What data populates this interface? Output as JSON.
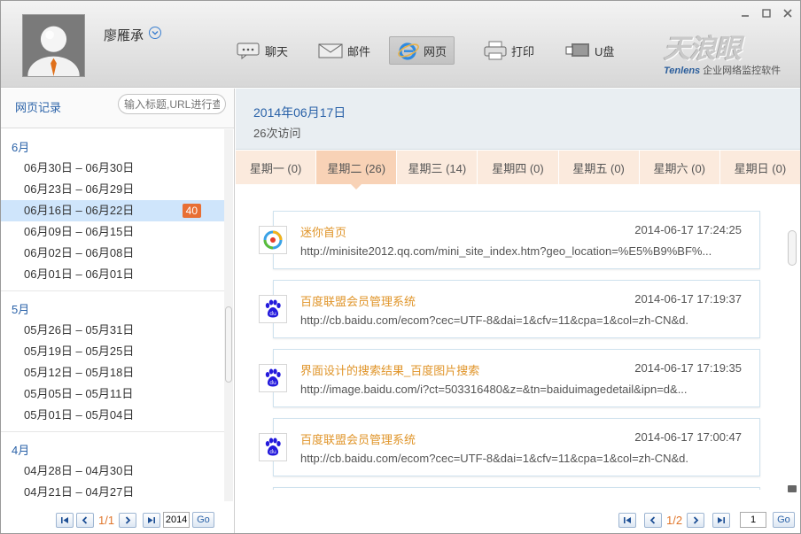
{
  "user": {
    "name": "廖雁承"
  },
  "nav": [
    {
      "label": "聊天",
      "icon": "chat-icon"
    },
    {
      "label": "邮件",
      "icon": "mail-icon"
    },
    {
      "label": "网页",
      "icon": "ie-icon",
      "active": true
    },
    {
      "label": "打印",
      "icon": "printer-icon"
    },
    {
      "label": "U盘",
      "icon": "usb-drive-icon"
    }
  ],
  "brand": {
    "logo": "天浪眼",
    "en": "Tenlens",
    "tagline": "企业网络监控软件"
  },
  "sidebar": {
    "title": "网页记录",
    "search_placeholder": "输入标题,URL进行查",
    "months": [
      {
        "name": "6月",
        "weeks": [
          {
            "label": "06月30日 – 06月30日"
          },
          {
            "label": "06月23日 – 06月29日"
          },
          {
            "label": "06月16日 – 06月22日",
            "count": "40",
            "selected": true
          },
          {
            "label": "06月09日 – 06月15日"
          },
          {
            "label": "06月02日 – 06月08日"
          },
          {
            "label": "06月01日 – 06月01日"
          }
        ]
      },
      {
        "name": "5月",
        "weeks": [
          {
            "label": "05月26日 – 05月31日"
          },
          {
            "label": "05月19日 – 05月25日"
          },
          {
            "label": "05月12日 – 05月18日"
          },
          {
            "label": "05月05日 – 05月11日"
          },
          {
            "label": "05月01日 – 05月04日"
          }
        ]
      },
      {
        "name": "4月",
        "weeks": [
          {
            "label": "04月28日 – 04月30日"
          },
          {
            "label": "04月21日 – 04月27日"
          }
        ]
      }
    ],
    "pager": {
      "page": "1/1",
      "year": "2014",
      "go": "Go"
    }
  },
  "main": {
    "date": "2014年06月17日",
    "visits": "26次访问",
    "tabs": [
      {
        "label": "星期一 (0)"
      },
      {
        "label": "星期二 (26)",
        "active": true
      },
      {
        "label": "星期三 (14)"
      },
      {
        "label": "星期四 (0)"
      },
      {
        "label": "星期五 (0)"
      },
      {
        "label": "星期六 (0)"
      },
      {
        "label": "星期日 (0)"
      }
    ],
    "records": [
      {
        "title": "迷你首页",
        "time": "2014-06-17 17:24:25",
        "url": "http://minisite2012.qq.com/mini_site_index.htm?geo_location=%E5%B9%BF%...",
        "icon": "qq-news-icon"
      },
      {
        "title": "百度联盟会员管理系统",
        "time": "2014-06-17 17:19:37",
        "url": "http://cb.baidu.com/ecom?cec=UTF-8&dai=1&cfv=11&cpa=1&col=zh-CN&d.",
        "icon": "baidu-icon"
      },
      {
        "title": "界面设计的搜索结果_百度图片搜索",
        "time": "2014-06-17 17:19:35",
        "url": "http://image.baidu.com/i?ct=503316480&z=&tn=baiduimagedetail&ipn=d&...",
        "icon": "baidu-icon"
      },
      {
        "title": "百度联盟会员管理系统",
        "time": "2014-06-17 17:00:47",
        "url": "http://cb.baidu.com/ecom?cec=UTF-8&dai=1&cfv=11&cpa=1&col=zh-CN&d.",
        "icon": "baidu-icon"
      }
    ],
    "pager": {
      "page": "1/2",
      "value": "1",
      "go": "Go"
    }
  },
  "colors": {
    "accent": "#2a62a8",
    "orange": "#e0952a",
    "badge": "#e86f34",
    "tab_active": "#f8d2b6"
  }
}
